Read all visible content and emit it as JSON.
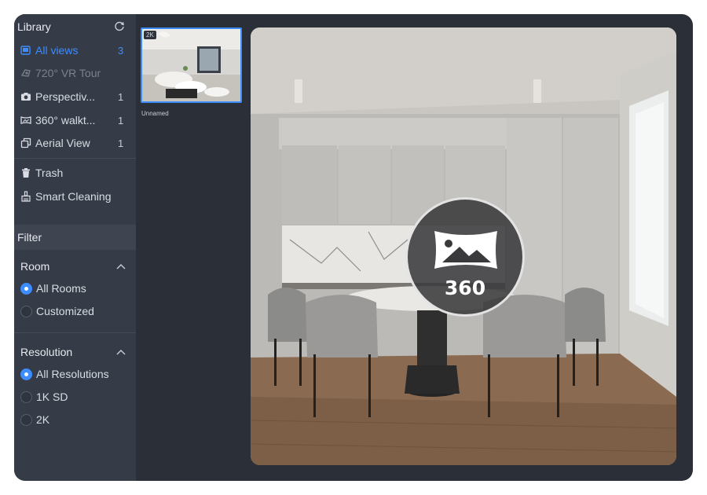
{
  "library": {
    "title": "Library",
    "items": [
      {
        "label": "All views",
        "count": "3",
        "icon": "gallery-icon"
      },
      {
        "label": "720° VR Tour",
        "count": "",
        "icon": "vr-tour-icon"
      },
      {
        "label": "Perspectiv...",
        "count": "1",
        "icon": "camera-icon"
      },
      {
        "label": "360° walkt...",
        "count": "1",
        "icon": "panorama-icon"
      },
      {
        "label": "Aerial View",
        "count": "1",
        "icon": "aerial-view-icon"
      }
    ],
    "trash_label": "Trash",
    "smart_cleaning_label": "Smart Cleaning"
  },
  "filter": {
    "title": "Filter",
    "room": {
      "title": "Room",
      "options": [
        "All Rooms",
        "Customized"
      ],
      "selected": "All Rooms"
    },
    "resolution": {
      "title": "Resolution",
      "options": [
        "All Resolutions",
        "1K SD",
        "2K"
      ],
      "selected": "All Resolutions"
    }
  },
  "thumbnails": [
    {
      "badge": "2K",
      "caption": "Unnamed",
      "selected": true
    }
  ],
  "preview": {
    "badge_text": "360",
    "badge_icon": "panorama-image-icon"
  },
  "colors": {
    "accent": "#3d8dff",
    "sidebar_bg": "#353c47",
    "window_bg": "#2a2f38"
  }
}
